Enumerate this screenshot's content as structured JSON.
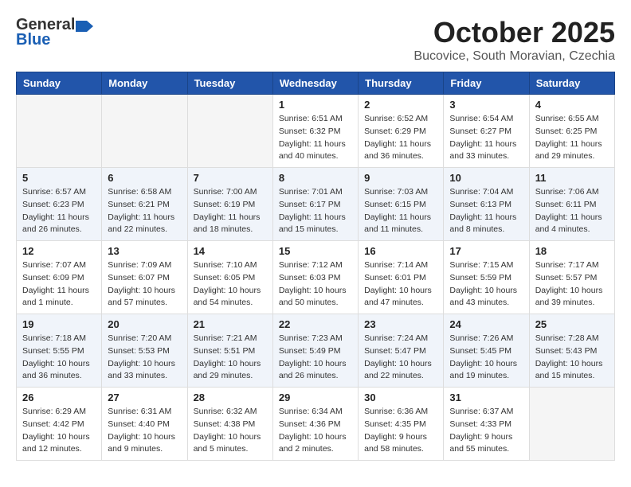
{
  "header": {
    "logo_general": "General",
    "logo_blue": "Blue",
    "title": "October 2025",
    "subtitle": "Bucovice, South Moravian, Czechia"
  },
  "calendar": {
    "days_of_week": [
      "Sunday",
      "Monday",
      "Tuesday",
      "Wednesday",
      "Thursday",
      "Friday",
      "Saturday"
    ],
    "weeks": [
      [
        {
          "day": "",
          "info": ""
        },
        {
          "day": "",
          "info": ""
        },
        {
          "day": "",
          "info": ""
        },
        {
          "day": "1",
          "info": "Sunrise: 6:51 AM\nSunset: 6:32 PM\nDaylight: 11 hours\nand 40 minutes."
        },
        {
          "day": "2",
          "info": "Sunrise: 6:52 AM\nSunset: 6:29 PM\nDaylight: 11 hours\nand 36 minutes."
        },
        {
          "day": "3",
          "info": "Sunrise: 6:54 AM\nSunset: 6:27 PM\nDaylight: 11 hours\nand 33 minutes."
        },
        {
          "day": "4",
          "info": "Sunrise: 6:55 AM\nSunset: 6:25 PM\nDaylight: 11 hours\nand 29 minutes."
        }
      ],
      [
        {
          "day": "5",
          "info": "Sunrise: 6:57 AM\nSunset: 6:23 PM\nDaylight: 11 hours\nand 26 minutes."
        },
        {
          "day": "6",
          "info": "Sunrise: 6:58 AM\nSunset: 6:21 PM\nDaylight: 11 hours\nand 22 minutes."
        },
        {
          "day": "7",
          "info": "Sunrise: 7:00 AM\nSunset: 6:19 PM\nDaylight: 11 hours\nand 18 minutes."
        },
        {
          "day": "8",
          "info": "Sunrise: 7:01 AM\nSunset: 6:17 PM\nDaylight: 11 hours\nand 15 minutes."
        },
        {
          "day": "9",
          "info": "Sunrise: 7:03 AM\nSunset: 6:15 PM\nDaylight: 11 hours\nand 11 minutes."
        },
        {
          "day": "10",
          "info": "Sunrise: 7:04 AM\nSunset: 6:13 PM\nDaylight: 11 hours\nand 8 minutes."
        },
        {
          "day": "11",
          "info": "Sunrise: 7:06 AM\nSunset: 6:11 PM\nDaylight: 11 hours\nand 4 minutes."
        }
      ],
      [
        {
          "day": "12",
          "info": "Sunrise: 7:07 AM\nSunset: 6:09 PM\nDaylight: 11 hours\nand 1 minute."
        },
        {
          "day": "13",
          "info": "Sunrise: 7:09 AM\nSunset: 6:07 PM\nDaylight: 10 hours\nand 57 minutes."
        },
        {
          "day": "14",
          "info": "Sunrise: 7:10 AM\nSunset: 6:05 PM\nDaylight: 10 hours\nand 54 minutes."
        },
        {
          "day": "15",
          "info": "Sunrise: 7:12 AM\nSunset: 6:03 PM\nDaylight: 10 hours\nand 50 minutes."
        },
        {
          "day": "16",
          "info": "Sunrise: 7:14 AM\nSunset: 6:01 PM\nDaylight: 10 hours\nand 47 minutes."
        },
        {
          "day": "17",
          "info": "Sunrise: 7:15 AM\nSunset: 5:59 PM\nDaylight: 10 hours\nand 43 minutes."
        },
        {
          "day": "18",
          "info": "Sunrise: 7:17 AM\nSunset: 5:57 PM\nDaylight: 10 hours\nand 39 minutes."
        }
      ],
      [
        {
          "day": "19",
          "info": "Sunrise: 7:18 AM\nSunset: 5:55 PM\nDaylight: 10 hours\nand 36 minutes."
        },
        {
          "day": "20",
          "info": "Sunrise: 7:20 AM\nSunset: 5:53 PM\nDaylight: 10 hours\nand 33 minutes."
        },
        {
          "day": "21",
          "info": "Sunrise: 7:21 AM\nSunset: 5:51 PM\nDaylight: 10 hours\nand 29 minutes."
        },
        {
          "day": "22",
          "info": "Sunrise: 7:23 AM\nSunset: 5:49 PM\nDaylight: 10 hours\nand 26 minutes."
        },
        {
          "day": "23",
          "info": "Sunrise: 7:24 AM\nSunset: 5:47 PM\nDaylight: 10 hours\nand 22 minutes."
        },
        {
          "day": "24",
          "info": "Sunrise: 7:26 AM\nSunset: 5:45 PM\nDaylight: 10 hours\nand 19 minutes."
        },
        {
          "day": "25",
          "info": "Sunrise: 7:28 AM\nSunset: 5:43 PM\nDaylight: 10 hours\nand 15 minutes."
        }
      ],
      [
        {
          "day": "26",
          "info": "Sunrise: 6:29 AM\nSunset: 4:42 PM\nDaylight: 10 hours\nand 12 minutes."
        },
        {
          "day": "27",
          "info": "Sunrise: 6:31 AM\nSunset: 4:40 PM\nDaylight: 10 hours\nand 9 minutes."
        },
        {
          "day": "28",
          "info": "Sunrise: 6:32 AM\nSunset: 4:38 PM\nDaylight: 10 hours\nand 5 minutes."
        },
        {
          "day": "29",
          "info": "Sunrise: 6:34 AM\nSunset: 4:36 PM\nDaylight: 10 hours\nand 2 minutes."
        },
        {
          "day": "30",
          "info": "Sunrise: 6:36 AM\nSunset: 4:35 PM\nDaylight: 9 hours\nand 58 minutes."
        },
        {
          "day": "31",
          "info": "Sunrise: 6:37 AM\nSunset: 4:33 PM\nDaylight: 9 hours\nand 55 minutes."
        },
        {
          "day": "",
          "info": ""
        }
      ]
    ]
  }
}
